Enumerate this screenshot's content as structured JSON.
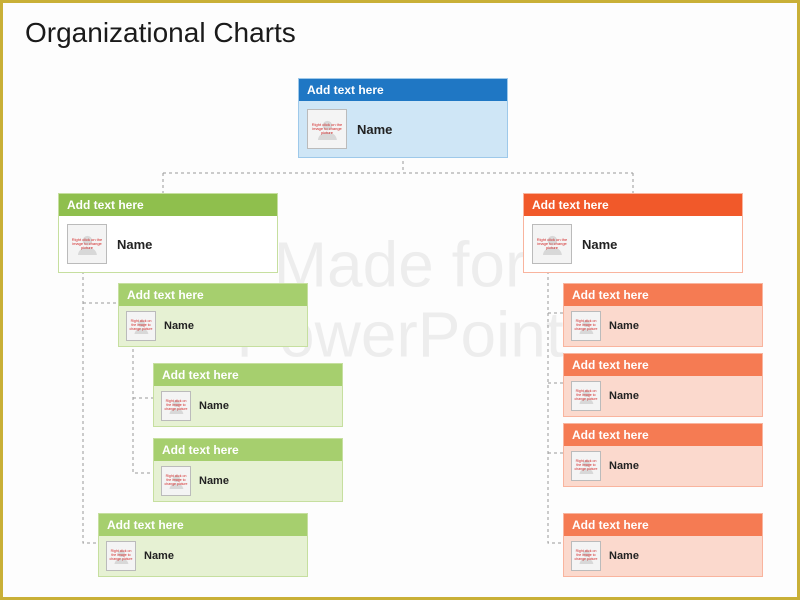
{
  "title": "Organizational Charts",
  "watermark": "Made for\nPowerPoint",
  "avatar_caption": "Right click on the image to change picture",
  "top": {
    "header": "Add text here",
    "name": "Name"
  },
  "left": {
    "header": "Add text here",
    "name": "Name",
    "children": [
      {
        "header": "Add text here",
        "name": "Name",
        "children": [
          {
            "header": "Add text here",
            "name": "Name"
          },
          {
            "header": "Add text here",
            "name": "Name"
          }
        ]
      },
      {
        "header": "Add text here",
        "name": "Name"
      }
    ]
  },
  "right": {
    "header": "Add text here",
    "name": "Name",
    "children": [
      {
        "header": "Add text here",
        "name": "Name"
      },
      {
        "header": "Add text here",
        "name": "Name"
      },
      {
        "header": "Add text here",
        "name": "Name"
      },
      {
        "header": "Add text here",
        "name": "Name"
      }
    ]
  }
}
